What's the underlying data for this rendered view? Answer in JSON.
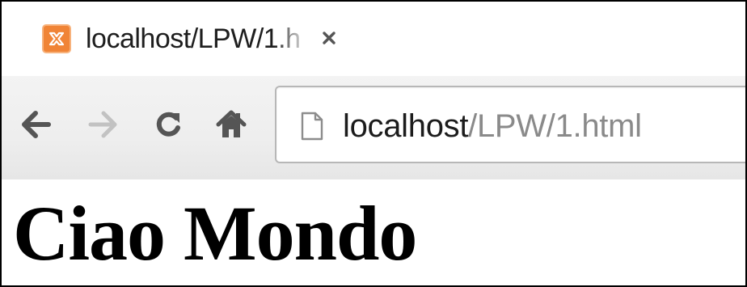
{
  "tab": {
    "title": "localhost/LPW/1.h",
    "favicon": "xampp-icon",
    "close_icon": "close-icon"
  },
  "toolbar": {
    "back_icon": "arrow-left-icon",
    "forward_icon": "arrow-right-icon",
    "reload_icon": "reload-icon",
    "home_icon": "home-icon"
  },
  "omnibox": {
    "page_icon": "page-icon",
    "url_host": "localhost",
    "url_path": "/LPW/1.html"
  },
  "page": {
    "heading": "Ciao Mondo"
  },
  "colors": {
    "favicon_orange": "#f08436",
    "toolbar_bg": "#eeeeee",
    "url_host": "#1c1c1c",
    "url_path": "#8a8a8a"
  }
}
